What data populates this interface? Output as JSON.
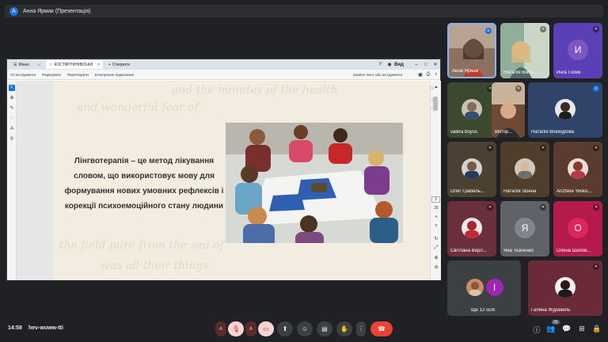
{
  "presenter_bar": {
    "badge": "А",
    "title": "Анна Ярмак (Презентація)"
  },
  "viewer": {
    "tabs": [
      {
        "label": "Меню"
      },
      {
        "label": "КОСТЯНТИНІВСЬКИ"
      },
      {
        "label": "Створити"
      }
    ],
    "view_label": "Вид",
    "toolbar": {
      "items": [
        "Усі інструменти",
        "Редагувати",
        "Перетворити",
        "Електронне підписання"
      ],
      "search_placeholder": "Знайти текст або інструменти"
    },
    "page_number": "3",
    "total_pages": "25"
  },
  "slide": {
    "text": "Лінгвотерапія – це метод лікування словом, що використовує мову для формування нових умовних рефлексів і корекції психоемоційного стану людини"
  },
  "participants": [
    {
      "name": "Анна Ярмак",
      "type": "video",
      "color": "#c0392b"
    },
    {
      "name": "Наталія Вікто...",
      "type": "video",
      "color": "#7d9c8a"
    },
    {
      "name": "Инга Голик",
      "type": "letter",
      "letter": "И",
      "color": "#5b3fb6"
    },
    {
      "name": "valera boyus",
      "type": "avatar",
      "color": "#3b4a2e"
    },
    {
      "name": "Віктор...",
      "type": "video",
      "color": "#5b3a2a"
    },
    {
      "name": "Наталія Вінокурова",
      "type": "avatar",
      "color": "#2f4468"
    },
    {
      "name": "Олег Грабель...",
      "type": "avatar",
      "color": "#4a4130"
    },
    {
      "name": "Наталія Зєніна",
      "type": "avatar",
      "color": "#4f3e2b"
    },
    {
      "name": "Anzhela Yesko...",
      "type": "avatar",
      "color": "#5a3b30"
    },
    {
      "name": "Світлана Верл...",
      "type": "avatar",
      "color": "#6b2f3a"
    },
    {
      "name": "Яна Ткаченко",
      "type": "letter",
      "letter": "Я",
      "color": "#5f6368"
    },
    {
      "name": "Олена Шапов...",
      "type": "letter",
      "letter": "О",
      "color": "#e0245e"
    },
    {
      "name": "Ще 12 осіб",
      "type": "group",
      "letter": "І",
      "color": "#3c4043"
    },
    {
      "name": "Галина Журавель",
      "type": "avatar",
      "color": "#6b2a38"
    }
  ],
  "bottom_bar": {
    "time": "14:58",
    "meeting_code": "hev-wuww-tti",
    "participants_count": "26"
  },
  "colors": {
    "accent": "#1a73e8",
    "end_call": "#ea4335",
    "background": "#202124"
  }
}
